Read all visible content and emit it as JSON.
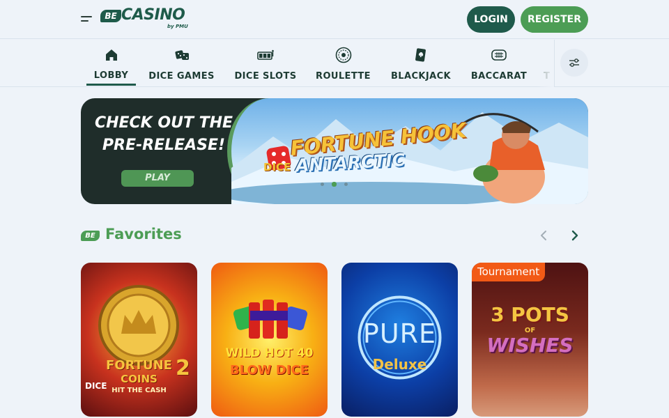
{
  "header": {
    "logo_prefix": "BE",
    "logo_text": "CASINO",
    "logo_sub": "by PMU",
    "login_label": "LOGIN",
    "register_label": "REGISTER"
  },
  "nav": {
    "items": [
      {
        "label": "LOBBY",
        "icon": "home-icon",
        "active": true
      },
      {
        "label": "DICE GAMES",
        "icon": "dice-icon"
      },
      {
        "label": "DICE SLOTS",
        "icon": "slot-machine-icon"
      },
      {
        "label": "ROULETTE",
        "icon": "roulette-icon"
      },
      {
        "label": "BLACKJACK",
        "icon": "cards-icon"
      },
      {
        "label": "BACCARAT",
        "icon": "baccarat-table-icon"
      },
      {
        "label": "T",
        "icon": ""
      }
    ]
  },
  "banner": {
    "headline_line1": "CHECK OUT THE",
    "headline_line2": "PRE-RELEASE!",
    "play_label": "PLAY",
    "game_title_line1": "FORTUNE HOOK",
    "game_title_line2": "ANTARCTIC",
    "game_prefix": "DICE"
  },
  "favorites": {
    "badge": "BE",
    "title": "Favorites",
    "cards": [
      {
        "line1": "FORTUNE",
        "line2": "COINS",
        "line3": "HIT THE CASH",
        "prefix": "DICE",
        "number": "2"
      },
      {
        "line1": "WILD HOT 40",
        "line2": "BLOW DICE"
      },
      {
        "line1": "PURE",
        "line2": "Deluxe"
      },
      {
        "line1": "3 POTS",
        "line2": "OF",
        "line3": "WISHES",
        "badge": "Tournament"
      }
    ]
  },
  "colors": {
    "brand_dark": "#1f5a4b",
    "brand_green": "#4c9d55",
    "background": "#eef3f9",
    "tournament": "#f25a16"
  }
}
